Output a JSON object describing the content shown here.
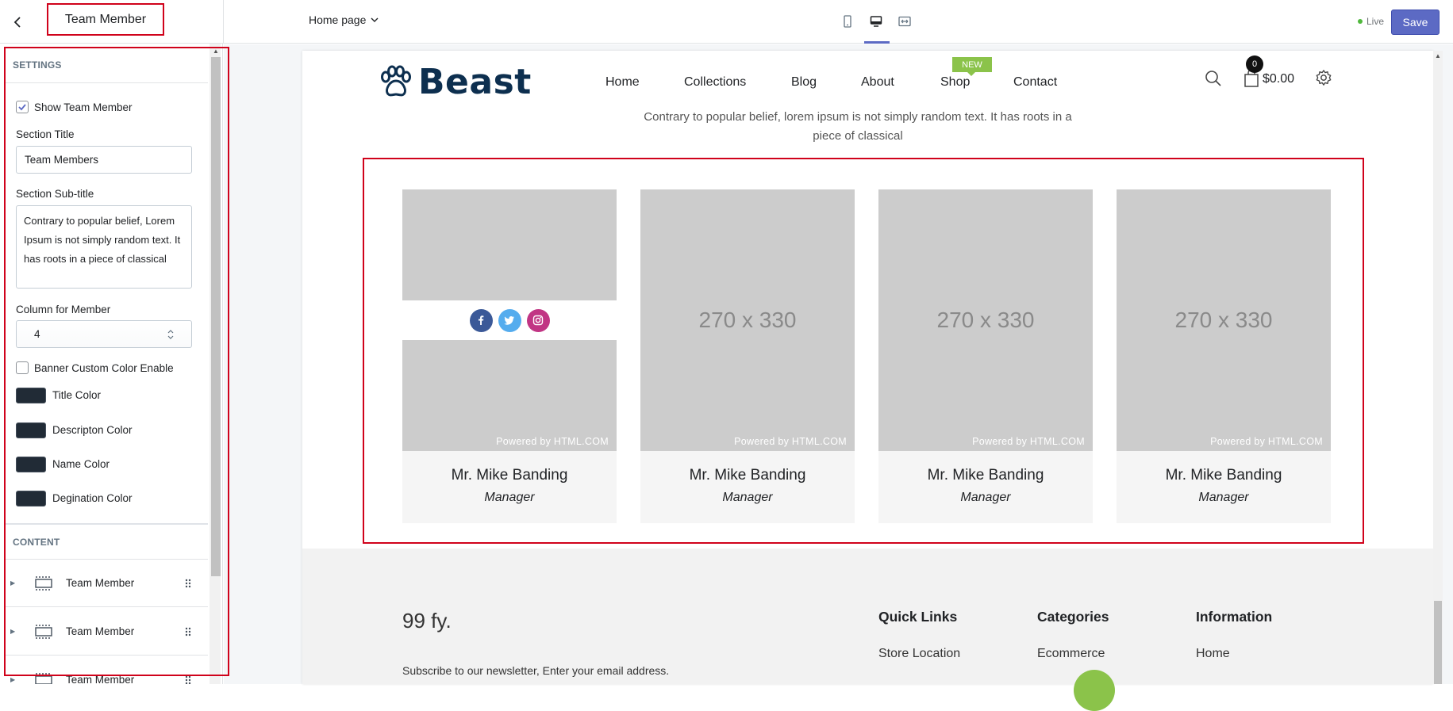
{
  "topbar": {
    "title": "Team Member",
    "page_selector": "Home page",
    "live_label": "Live",
    "save_label": "Save"
  },
  "sidebar": {
    "settings_heading": "SETTINGS",
    "show_team_member": {
      "label": "Show Team Member",
      "checked": true
    },
    "section_title": {
      "label": "Section Title",
      "value": "Team Members"
    },
    "section_subtitle": {
      "label": "Section Sub-title",
      "value": "Contrary to popular belief, Lorem Ipsum is not simply random text. It has roots in a piece of classical"
    },
    "column_for_member": {
      "label": "Column for Member",
      "value": "4"
    },
    "banner_custom_color": {
      "label": "Banner Custom Color Enable",
      "checked": false
    },
    "colors": [
      {
        "label": "Title Color",
        "value": "#212b36"
      },
      {
        "label": "Descripton Color",
        "value": "#212b36"
      },
      {
        "label": "Name Color",
        "value": "#212b36"
      },
      {
        "label": "Degination Color",
        "value": "#212b36"
      }
    ],
    "content_heading": "CONTENT",
    "blocks": [
      {
        "label": "Team Member"
      },
      {
        "label": "Team Member"
      },
      {
        "label": "Team Member"
      }
    ]
  },
  "preview": {
    "logo_text": "Beast",
    "nav": [
      "Home",
      "Collections",
      "Blog",
      "About",
      "Shop",
      "Contact"
    ],
    "new_badge": "NEW",
    "cart_count": "0",
    "cart_total": "$0.00",
    "subtitle": "Contrary to popular belief, lorem ipsum is not simply random text. It has roots in a piece of classical",
    "members": [
      {
        "placeholder": "",
        "powered": "Powered by HTML.COM",
        "name": "Mr. Mike Banding",
        "role": "Manager"
      },
      {
        "placeholder": "270 x 330",
        "powered": "Powered by HTML.COM",
        "name": "Mr. Mike Banding",
        "role": "Manager"
      },
      {
        "placeholder": "270 x 330",
        "powered": "Powered by HTML.COM",
        "name": "Mr. Mike Banding",
        "role": "Manager"
      },
      {
        "placeholder": "270 x 330",
        "powered": "Powered by HTML.COM",
        "name": "Mr. Mike Banding",
        "role": "Manager"
      }
    ],
    "social_icons": [
      "facebook-icon",
      "twitter-icon",
      "instagram-icon"
    ],
    "social_colors": [
      "#3b5998",
      "#55acee",
      "#c13584"
    ],
    "footer": {
      "brand": "99 fy.",
      "newsletter": "Subscribe to our newsletter, Enter your email address.",
      "columns": [
        {
          "heading": "Quick Links",
          "first_link": "Store Location"
        },
        {
          "heading": "Categories",
          "first_link": "Ecommerce"
        },
        {
          "heading": "Information",
          "first_link": "Home"
        }
      ]
    }
  }
}
